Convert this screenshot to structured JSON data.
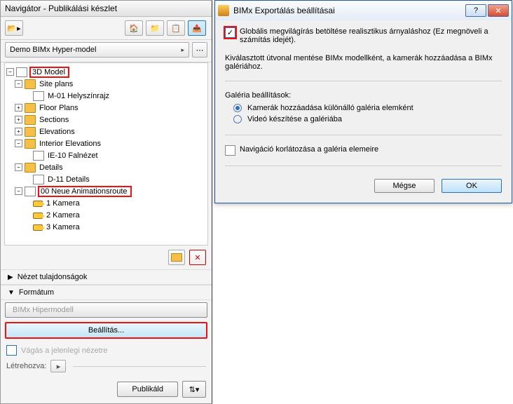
{
  "nav": {
    "title": "Navigátor - Publikálási készlet",
    "dropdown": "Demo BIMx Hyper-model",
    "sections": {
      "view_props": "Nézet tulajdonságok",
      "format": "Formátum"
    },
    "format_value": "BIMx Hipermodell",
    "settings_btn": "Beállítás...",
    "clip_checkbox": "Vágás a jelenlegi nézetre",
    "created_label": "Létrehozva:",
    "publish_btn": "Publikáld"
  },
  "tree": {
    "root": "3D Model",
    "site_plans": "Site plans",
    "site_plans_child": "M-01 Helyszínrajz",
    "floor_plans": "Floor Plans",
    "sections": "Sections",
    "elevations": "Elevations",
    "interior_elev": "Interior Elevations",
    "interior_child": "IE-10 Falnézet",
    "details": "Details",
    "details_child": "D-11 Details",
    "anim": "00 Neue Animationsroute",
    "cam1": "1 Kamera",
    "cam2": "2 Kamera",
    "cam3": "3 Kamera"
  },
  "dialog": {
    "title": "BIMx Exportálás beállításai",
    "opt_global": "Globális megvilágírás betöltése realisztikus árnyaláshoz (Ez megnöveli a számítás idejét).",
    "desc": "Kiválasztott útvonal mentése BIMx modellként, a kamerák hozzáadása a BIMx galériához.",
    "gallery_title": "Galéria beállítások:",
    "radio_add": "Kamerák hozzáadása különálló galéria elemként",
    "radio_video": "Videó készítése a galériába",
    "nav_limit": "Navigáció korlátozása a galéria elemeire",
    "cancel": "Mégse",
    "ok": "OK"
  }
}
